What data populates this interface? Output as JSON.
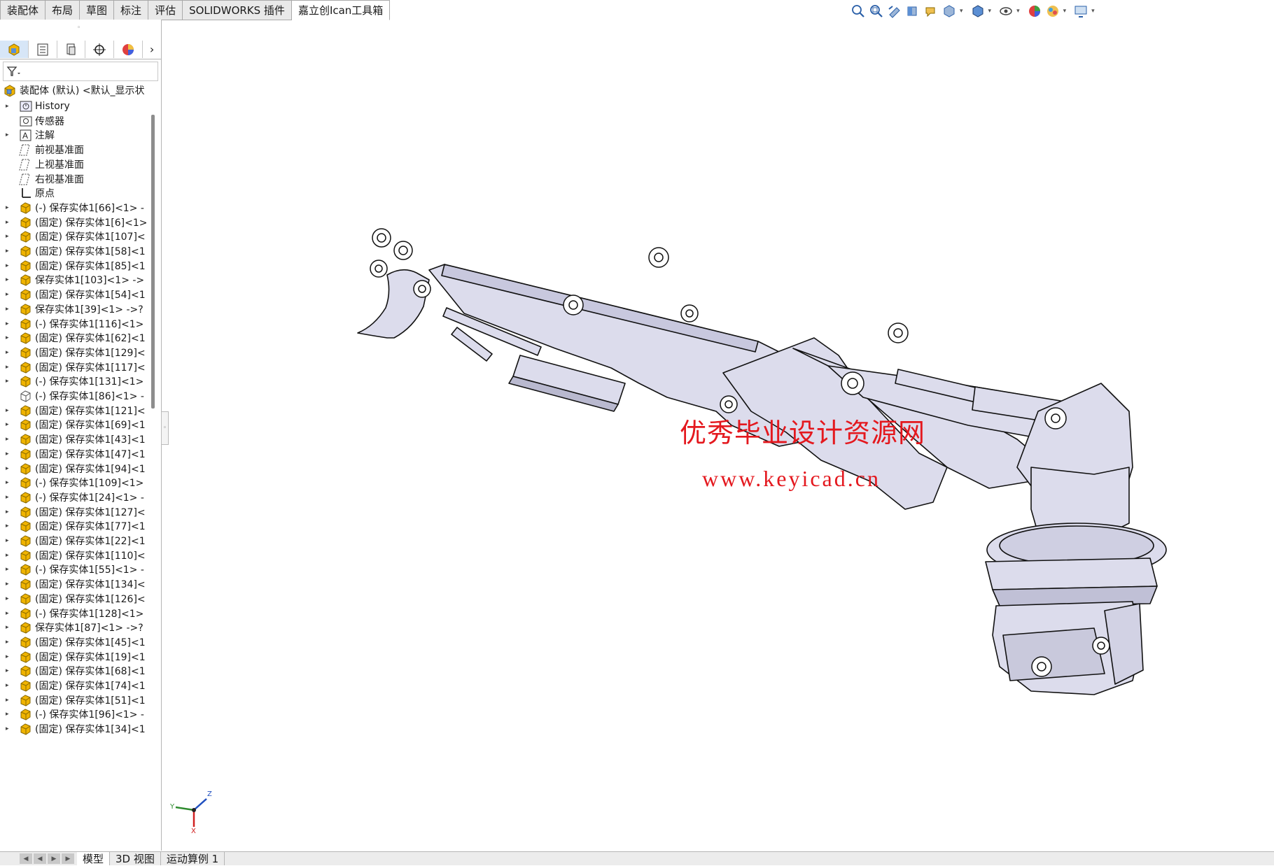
{
  "command_tabs": [
    "装配体",
    "布局",
    "草图",
    "标注",
    "评估",
    "SOLIDWORKS 插件",
    "嘉立创Ican工具箱"
  ],
  "active_command_tab": "嘉立创Ican工具箱",
  "heads_up_toolbar": [
    "zoom-to-fit-icon",
    "zoom-to-area-icon",
    "previous-view-icon",
    "section-view-icon",
    "dynamic-annotation-icon",
    "view-orientation-icon",
    "display-style-icon",
    "hide-show-items-icon",
    "edit-appearance-icon",
    "apply-scene-icon",
    "view-settings-icon"
  ],
  "panel_tabs": [
    "featuremanager-tab-icon",
    "propertymanager-tab-icon",
    "configurationmanager-tab-icon",
    "dimxpert-tab-icon",
    "display-manager-tab-icon"
  ],
  "tree": {
    "root": "装配体 (默认) <默认_显示状",
    "items": [
      {
        "label": "History",
        "icon": "history",
        "arrow": true
      },
      {
        "label": "传感器",
        "icon": "sensor",
        "arrow": false
      },
      {
        "label": "注解",
        "icon": "annotation",
        "arrow": true
      },
      {
        "label": "前视基准面",
        "icon": "plane",
        "arrow": false
      },
      {
        "label": "上视基准面",
        "icon": "plane",
        "arrow": false
      },
      {
        "label": "右视基准面",
        "icon": "plane",
        "arrow": false
      },
      {
        "label": "原点",
        "icon": "origin",
        "arrow": false
      },
      {
        "label": "(-) 保存实体1[66]<1> -",
        "icon": "part",
        "arrow": true
      },
      {
        "label": "(固定) 保存实体1[6]<1>",
        "icon": "part",
        "arrow": true
      },
      {
        "label": "(固定) 保存实体1[107]<",
        "icon": "part",
        "arrow": true
      },
      {
        "label": "(固定) 保存实体1[58]<1",
        "icon": "part",
        "arrow": true
      },
      {
        "label": "(固定) 保存实体1[85]<1",
        "icon": "part",
        "arrow": true
      },
      {
        "label": "保存实体1[103]<1> ->",
        "icon": "part",
        "arrow": true
      },
      {
        "label": "(固定) 保存实体1[54]<1",
        "icon": "part",
        "arrow": true
      },
      {
        "label": "保存实体1[39]<1> ->?",
        "icon": "part",
        "arrow": true
      },
      {
        "label": "(-) 保存实体1[116]<1>",
        "icon": "part",
        "arrow": true
      },
      {
        "label": "(固定) 保存实体1[62]<1",
        "icon": "part",
        "arrow": true
      },
      {
        "label": "(固定) 保存实体1[129]<",
        "icon": "part",
        "arrow": true
      },
      {
        "label": "(固定) 保存实体1[117]<",
        "icon": "part",
        "arrow": true
      },
      {
        "label": "(-) 保存实体1[131]<1>",
        "icon": "part",
        "arrow": true
      },
      {
        "label": "(-) 保存实体1[86]<1> -",
        "icon": "part-hidden",
        "arrow": false
      },
      {
        "label": "(固定) 保存实体1[121]<",
        "icon": "part",
        "arrow": true
      },
      {
        "label": "(固定) 保存实体1[69]<1",
        "icon": "part",
        "arrow": true
      },
      {
        "label": "(固定) 保存实体1[43]<1",
        "icon": "part",
        "arrow": true
      },
      {
        "label": "(固定) 保存实体1[47]<1",
        "icon": "part",
        "arrow": true
      },
      {
        "label": "(固定) 保存实体1[94]<1",
        "icon": "part",
        "arrow": true
      },
      {
        "label": "(-) 保存实体1[109]<1>",
        "icon": "part",
        "arrow": true
      },
      {
        "label": "(-) 保存实体1[24]<1> -",
        "icon": "part",
        "arrow": true
      },
      {
        "label": "(固定) 保存实体1[127]<",
        "icon": "part",
        "arrow": true
      },
      {
        "label": "(固定) 保存实体1[77]<1",
        "icon": "part",
        "arrow": true
      },
      {
        "label": "(固定) 保存实体1[22]<1",
        "icon": "part",
        "arrow": true
      },
      {
        "label": "(固定) 保存实体1[110]<",
        "icon": "part",
        "arrow": true
      },
      {
        "label": "(-) 保存实体1[55]<1> -",
        "icon": "part",
        "arrow": true
      },
      {
        "label": "(固定) 保存实体1[134]<",
        "icon": "part",
        "arrow": true
      },
      {
        "label": "(固定) 保存实体1[126]<",
        "icon": "part",
        "arrow": true
      },
      {
        "label": "(-) 保存实体1[128]<1>",
        "icon": "part",
        "arrow": true
      },
      {
        "label": "保存实体1[87]<1> ->?",
        "icon": "part",
        "arrow": true
      },
      {
        "label": "(固定) 保存实体1[45]<1",
        "icon": "part",
        "arrow": true
      },
      {
        "label": "(固定) 保存实体1[19]<1",
        "icon": "part",
        "arrow": true
      },
      {
        "label": "(固定) 保存实体1[68]<1",
        "icon": "part",
        "arrow": true
      },
      {
        "label": "(固定) 保存实体1[74]<1",
        "icon": "part",
        "arrow": true
      },
      {
        "label": "(固定) 保存实体1[51]<1",
        "icon": "part",
        "arrow": true
      },
      {
        "label": "(-) 保存实体1[96]<1> -",
        "icon": "part",
        "arrow": true
      },
      {
        "label": "(固定) 保存实体1[34]<1",
        "icon": "part",
        "arrow": true
      }
    ]
  },
  "viewport": {
    "watermark_title": "优秀毕业设计资源网",
    "watermark_url": "www.keyicad.cn",
    "triad": {
      "y": "Y",
      "z": "Z",
      "x": "X"
    }
  },
  "bottom_tabs": [
    "模型",
    "3D 视图",
    "运动算例 1"
  ],
  "active_bottom_tab": "模型",
  "colors": {
    "watermark": "#e4181e",
    "model_fill": "#dcdcec",
    "part_icon": "#f0b400"
  }
}
